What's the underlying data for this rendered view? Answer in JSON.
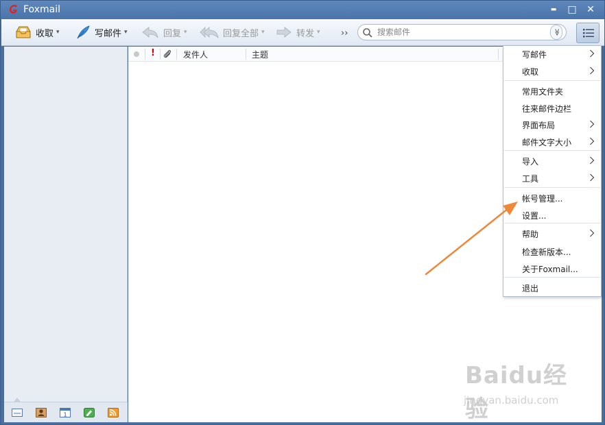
{
  "window": {
    "title": "Foxmail",
    "min_glyph": "▬",
    "max_glyph": "□",
    "close_glyph": "✕"
  },
  "toolbar": {
    "receive_label": "收取",
    "compose_label": "写邮件",
    "reply_label": "回复",
    "reply_all_label": "回复全部",
    "forward_label": "转发",
    "more_label": "››",
    "dropdown_caret": "▾"
  },
  "search": {
    "placeholder": "搜索邮件",
    "dropdown_glyph": "≫"
  },
  "list_header": {
    "sender": "发件人",
    "subject": "主题"
  },
  "menu": {
    "items": [
      {
        "label": "写邮件",
        "submenu": true
      },
      {
        "label": "收取",
        "submenu": true
      },
      {
        "label": "常用文件夹",
        "submenu": false
      },
      {
        "label": "往来邮件边栏",
        "submenu": false
      },
      {
        "label": "界面布局",
        "submenu": true
      },
      {
        "label": "邮件文字大小",
        "submenu": true
      },
      {
        "label": "导入",
        "submenu": true
      },
      {
        "label": "工具",
        "submenu": true
      },
      {
        "label": "帐号管理...",
        "submenu": false
      },
      {
        "label": "设置...",
        "submenu": false
      },
      {
        "label": "帮助",
        "submenu": true
      },
      {
        "label": "检查新版本...",
        "submenu": false
      },
      {
        "label": "关于Foxmail...",
        "submenu": false
      },
      {
        "label": "退出",
        "submenu": false
      }
    ]
  },
  "watermark": {
    "brand": "Baidu经验",
    "url": "jingyan.baidu.com"
  },
  "colors": {
    "titlebar": "#4a75aa",
    "annotation_arrow": "#f0883a",
    "alert_red": "#cc0000"
  }
}
